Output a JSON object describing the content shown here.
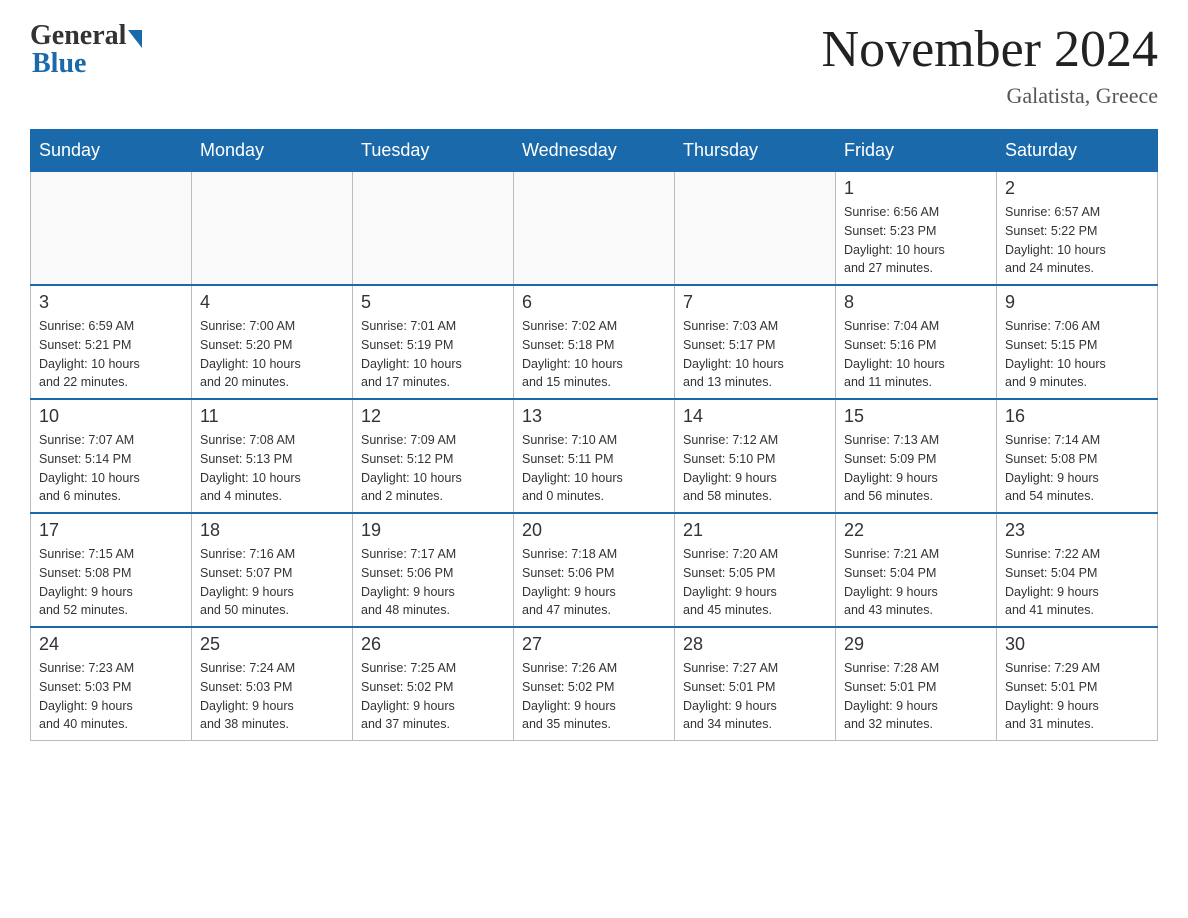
{
  "header": {
    "logo_general": "General",
    "logo_blue": "Blue",
    "title": "November 2024",
    "location": "Galatista, Greece"
  },
  "days_of_week": [
    "Sunday",
    "Monday",
    "Tuesday",
    "Wednesday",
    "Thursday",
    "Friday",
    "Saturday"
  ],
  "weeks": [
    [
      {
        "day": "",
        "info": ""
      },
      {
        "day": "",
        "info": ""
      },
      {
        "day": "",
        "info": ""
      },
      {
        "day": "",
        "info": ""
      },
      {
        "day": "",
        "info": ""
      },
      {
        "day": "1",
        "info": "Sunrise: 6:56 AM\nSunset: 5:23 PM\nDaylight: 10 hours\nand 27 minutes."
      },
      {
        "day": "2",
        "info": "Sunrise: 6:57 AM\nSunset: 5:22 PM\nDaylight: 10 hours\nand 24 minutes."
      }
    ],
    [
      {
        "day": "3",
        "info": "Sunrise: 6:59 AM\nSunset: 5:21 PM\nDaylight: 10 hours\nand 22 minutes."
      },
      {
        "day": "4",
        "info": "Sunrise: 7:00 AM\nSunset: 5:20 PM\nDaylight: 10 hours\nand 20 minutes."
      },
      {
        "day": "5",
        "info": "Sunrise: 7:01 AM\nSunset: 5:19 PM\nDaylight: 10 hours\nand 17 minutes."
      },
      {
        "day": "6",
        "info": "Sunrise: 7:02 AM\nSunset: 5:18 PM\nDaylight: 10 hours\nand 15 minutes."
      },
      {
        "day": "7",
        "info": "Sunrise: 7:03 AM\nSunset: 5:17 PM\nDaylight: 10 hours\nand 13 minutes."
      },
      {
        "day": "8",
        "info": "Sunrise: 7:04 AM\nSunset: 5:16 PM\nDaylight: 10 hours\nand 11 minutes."
      },
      {
        "day": "9",
        "info": "Sunrise: 7:06 AM\nSunset: 5:15 PM\nDaylight: 10 hours\nand 9 minutes."
      }
    ],
    [
      {
        "day": "10",
        "info": "Sunrise: 7:07 AM\nSunset: 5:14 PM\nDaylight: 10 hours\nand 6 minutes."
      },
      {
        "day": "11",
        "info": "Sunrise: 7:08 AM\nSunset: 5:13 PM\nDaylight: 10 hours\nand 4 minutes."
      },
      {
        "day": "12",
        "info": "Sunrise: 7:09 AM\nSunset: 5:12 PM\nDaylight: 10 hours\nand 2 minutes."
      },
      {
        "day": "13",
        "info": "Sunrise: 7:10 AM\nSunset: 5:11 PM\nDaylight: 10 hours\nand 0 minutes."
      },
      {
        "day": "14",
        "info": "Sunrise: 7:12 AM\nSunset: 5:10 PM\nDaylight: 9 hours\nand 58 minutes."
      },
      {
        "day": "15",
        "info": "Sunrise: 7:13 AM\nSunset: 5:09 PM\nDaylight: 9 hours\nand 56 minutes."
      },
      {
        "day": "16",
        "info": "Sunrise: 7:14 AM\nSunset: 5:08 PM\nDaylight: 9 hours\nand 54 minutes."
      }
    ],
    [
      {
        "day": "17",
        "info": "Sunrise: 7:15 AM\nSunset: 5:08 PM\nDaylight: 9 hours\nand 52 minutes."
      },
      {
        "day": "18",
        "info": "Sunrise: 7:16 AM\nSunset: 5:07 PM\nDaylight: 9 hours\nand 50 minutes."
      },
      {
        "day": "19",
        "info": "Sunrise: 7:17 AM\nSunset: 5:06 PM\nDaylight: 9 hours\nand 48 minutes."
      },
      {
        "day": "20",
        "info": "Sunrise: 7:18 AM\nSunset: 5:06 PM\nDaylight: 9 hours\nand 47 minutes."
      },
      {
        "day": "21",
        "info": "Sunrise: 7:20 AM\nSunset: 5:05 PM\nDaylight: 9 hours\nand 45 minutes."
      },
      {
        "day": "22",
        "info": "Sunrise: 7:21 AM\nSunset: 5:04 PM\nDaylight: 9 hours\nand 43 minutes."
      },
      {
        "day": "23",
        "info": "Sunrise: 7:22 AM\nSunset: 5:04 PM\nDaylight: 9 hours\nand 41 minutes."
      }
    ],
    [
      {
        "day": "24",
        "info": "Sunrise: 7:23 AM\nSunset: 5:03 PM\nDaylight: 9 hours\nand 40 minutes."
      },
      {
        "day": "25",
        "info": "Sunrise: 7:24 AM\nSunset: 5:03 PM\nDaylight: 9 hours\nand 38 minutes."
      },
      {
        "day": "26",
        "info": "Sunrise: 7:25 AM\nSunset: 5:02 PM\nDaylight: 9 hours\nand 37 minutes."
      },
      {
        "day": "27",
        "info": "Sunrise: 7:26 AM\nSunset: 5:02 PM\nDaylight: 9 hours\nand 35 minutes."
      },
      {
        "day": "28",
        "info": "Sunrise: 7:27 AM\nSunset: 5:01 PM\nDaylight: 9 hours\nand 34 minutes."
      },
      {
        "day": "29",
        "info": "Sunrise: 7:28 AM\nSunset: 5:01 PM\nDaylight: 9 hours\nand 32 minutes."
      },
      {
        "day": "30",
        "info": "Sunrise: 7:29 AM\nSunset: 5:01 PM\nDaylight: 9 hours\nand 31 minutes."
      }
    ]
  ]
}
